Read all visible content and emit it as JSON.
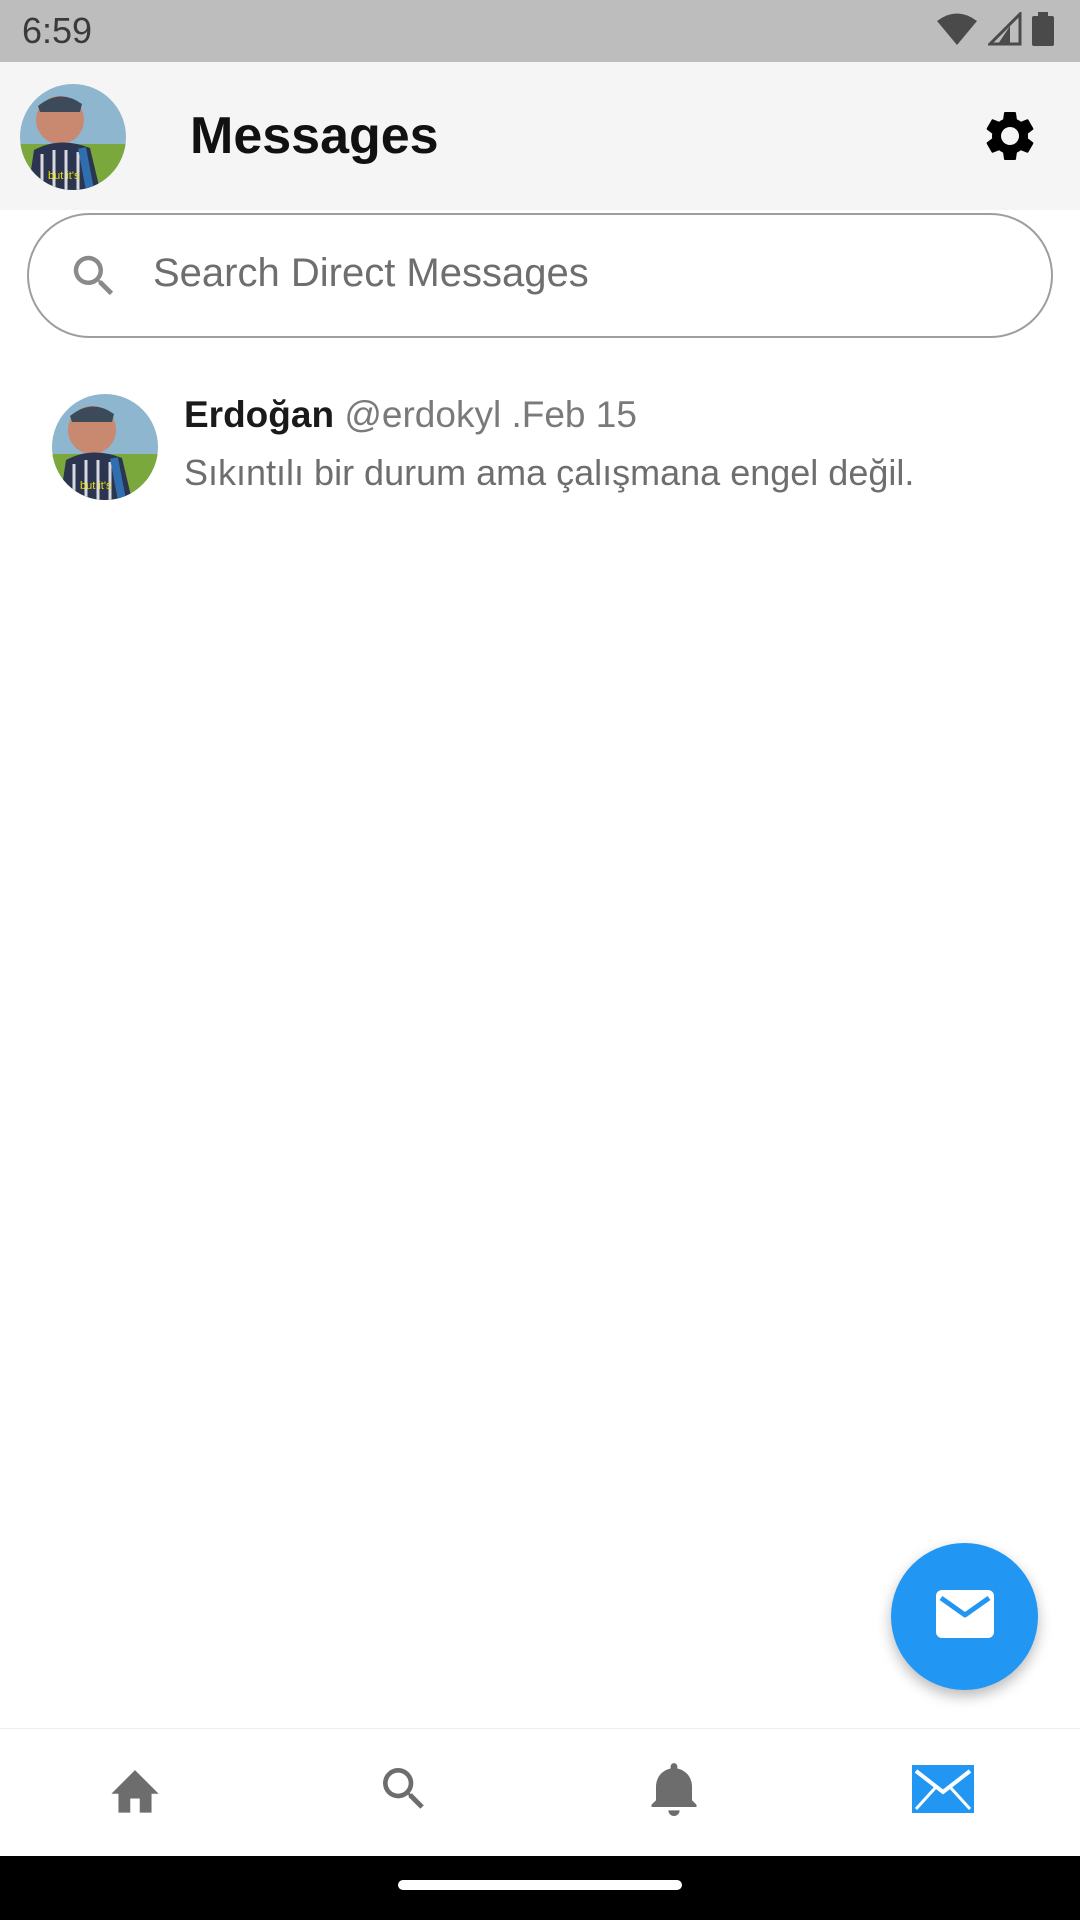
{
  "status_bar": {
    "time": "6:59",
    "icons": [
      "wifi-icon",
      "cellular-signal-icon",
      "battery-icon"
    ]
  },
  "header": {
    "title": "Messages",
    "avatar_caption": "but it's",
    "settings_icon": "gear-icon"
  },
  "search": {
    "placeholder": "Search Direct Messages",
    "icon": "search-icon"
  },
  "conversations": [
    {
      "name": "Erdoğan",
      "handle": "@erdokyl",
      "date": ".Feb 15",
      "preview": "Sıkıntılı bir durum ama çalışmana engel değil.",
      "avatar_caption": "but it's"
    }
  ],
  "fab": {
    "icon": "mail-icon",
    "color": "#2196F3"
  },
  "bottom_nav": {
    "items": [
      {
        "icon": "home-icon",
        "active": false
      },
      {
        "icon": "search-icon",
        "active": false
      },
      {
        "icon": "bell-icon",
        "active": false
      },
      {
        "icon": "mail-icon",
        "active": true
      }
    ],
    "active_color": "#2196F3",
    "inactive_color": "#6d6d6d"
  }
}
